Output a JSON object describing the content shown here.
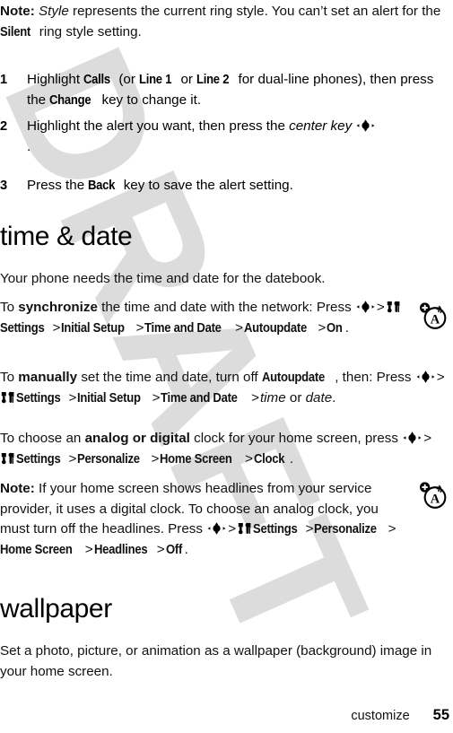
{
  "document": {
    "watermark": "DRAFT",
    "footer": {
      "section": "customize",
      "page_number": "55"
    }
  },
  "blocks": {
    "note_style": {
      "label": "Note:",
      "text_1": " ",
      "italic_style": "Style",
      "text_2": " represents the current ring style. You can’t set an alert for the ",
      "ui_silent": "Silent",
      "text_3": " ring style setting."
    },
    "steps": [
      {
        "number": "1",
        "t1": "Highlight ",
        "ui1": "Calls",
        "t2": " (or ",
        "ui2": "Line 1",
        "t3": " or ",
        "ui3": "Line 2",
        "t4": " for dual-line phones), then press the ",
        "ui4": "Change",
        "t5": " key to change it."
      },
      {
        "number": "2",
        "t1": "Highlight the alert you want, then press the ",
        "italic": "center key",
        "t2": " ",
        "icon": "center-key-icon",
        "t3": "."
      },
      {
        "number": "3",
        "t1": "Press the ",
        "ui1": "Back",
        "t2": " key to save the alert setting."
      }
    ],
    "heading_time_date": "time & date",
    "para_datebook": "Your phone needs the time and date for the datebook.",
    "para_synchronize": {
      "t1": "To ",
      "bold": "synchronize",
      "t2": " the time and date with the network: Press ",
      "icon_center": "center-key-icon",
      "sep1": ">",
      "icon_settings": "settings-tools-icon",
      "ui1": "Settings",
      "sep2": ">",
      "ui2": "Initial Setup",
      "sep3": ">",
      "ui3": "Time and Date",
      "sep4": ">",
      "ui4": "Autoupdate",
      "sep5": ">",
      "ui5": "On",
      "t3": "."
    },
    "para_manually": {
      "t1": "To ",
      "bold": "manually",
      "t2": " set the time and date, turn off ",
      "ui_autoupdate": "Autoupdate",
      "t3": ", then: Press ",
      "icon_center": "center-key-icon",
      "sep1": ">",
      "icon_settings": "settings-tools-icon",
      "ui1": "Settings",
      "sep2": ">",
      "ui2": "Initial Setup",
      "sep3": ">",
      "ui3": "Time and Date",
      "sep4": ">",
      "ital1": "time",
      "t4": " or ",
      "ital2": "date",
      "t5": "."
    },
    "para_analog_digital": {
      "t1": "To choose an ",
      "bold": "analog or digital",
      "t2": " clock for your home screen, press ",
      "icon_center": "center-key-icon",
      "sep1": ">",
      "icon_settings": "settings-tools-icon",
      "ui1": "Settings",
      "sep2": ">",
      "ui2": "Personalize",
      "sep3": ">",
      "ui3": "Home Screen",
      "sep4": ">",
      "ui4": "Clock",
      "t3": "."
    },
    "note_headlines": {
      "label": "Note:",
      "t1": " If your home screen shows headlines from your service provider, it uses a digital clock. To choose an analog clock, you must turn off the headlines. Press ",
      "icon_center": "center-key-icon",
      "sep1": ">",
      "icon_settings": "settings-tools-icon",
      "ui1": "Settings",
      "sep2": ">",
      "ui2": "Personalize",
      "sep3": ">",
      "ui3": "Home Screen",
      "sep4": ">",
      "ui4": "Headlines",
      "sep5": ">",
      "ui5": "Off",
      "t2": "."
    },
    "heading_wallpaper": "wallpaper",
    "para_wallpaper": "Set a photo, picture, or animation as a wallpaper (background) image in your home screen."
  },
  "margin_icons": [
    {
      "name": "network-feature-icon",
      "letter": "A"
    },
    {
      "name": "network-feature-icon",
      "letter": "A"
    }
  ],
  "colors": {
    "text": "#111111",
    "watermark": "#dcdcdc",
    "page_bg": "#ffffff"
  }
}
